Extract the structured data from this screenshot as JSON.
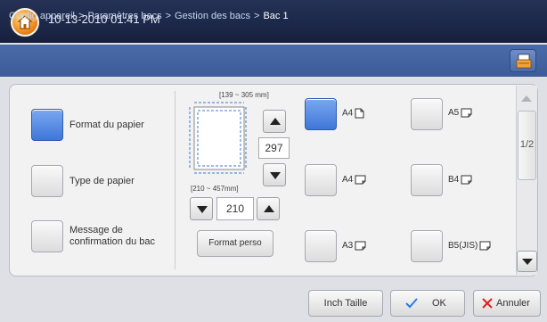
{
  "header": {
    "datetime": "10-13-2010 01:41 PM"
  },
  "breadcrumb": {
    "items": [
      "Config appareil",
      "Paramètres bacs",
      "Gestion des bacs",
      "Bac 1"
    ],
    "separator": ">"
  },
  "left_options": [
    {
      "label": "Format du papier",
      "selected": true
    },
    {
      "label": "Type de papier",
      "selected": false
    },
    {
      "label": "Message de confirmation du bac",
      "selected": false
    }
  ],
  "custom_size": {
    "width_range": "[139 ~ 305 mm]",
    "length_range": "[210 ~ 457mm]",
    "width_value": "297",
    "length_value": "210",
    "custom_button": "Format perso"
  },
  "paper_sizes": [
    {
      "label": "A4",
      "orientation": "portrait-icon",
      "selected": true
    },
    {
      "label": "A5",
      "orientation": "landscape-icon",
      "selected": false
    },
    {
      "label": "A4",
      "orientation": "landscape-icon",
      "selected": false
    },
    {
      "label": "B4",
      "orientation": "landscape-icon",
      "selected": false
    },
    {
      "label": "A3",
      "orientation": "landscape-icon",
      "selected": false
    },
    {
      "label": "B5(JIS)",
      "orientation": "landscape-icon",
      "selected": false
    }
  ],
  "pager": {
    "indicator": "1/2"
  },
  "footer": {
    "inch_label": "Inch Taille",
    "ok_label": "OK",
    "cancel_label": "Annuler"
  },
  "colors": {
    "accent": "#3f76d8",
    "topbar": "#1b2646",
    "breadbar": "#4a6aa8",
    "ok_check": "#2a7be0",
    "cancel_x": "#e02020"
  }
}
